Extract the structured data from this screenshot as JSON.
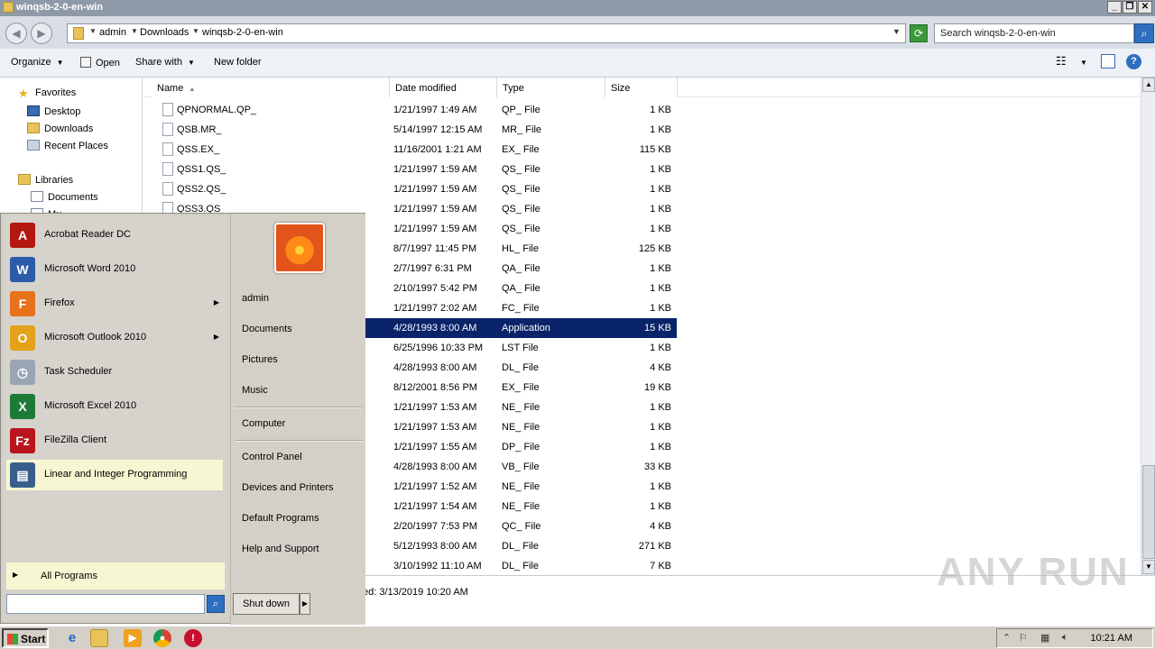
{
  "window": {
    "title": "winqsb-2-0-en-win"
  },
  "address": {
    "crumbs": [
      "admin",
      "Downloads",
      "winqsb-2-0-en-win"
    ],
    "search_placeholder": "Search winqsb-2-0-en-win"
  },
  "toolbar": {
    "organize": "Organize",
    "open": "Open",
    "share_with": "Share with",
    "new_folder": "New folder"
  },
  "nav": {
    "favorites": "Favorites",
    "desktop": "Desktop",
    "downloads": "Downloads",
    "recent_places": "Recent Places",
    "libraries": "Libraries",
    "documents": "Documents",
    "music_partial": "Mu"
  },
  "columns": {
    "name": "Name",
    "date": "Date modified",
    "type": "Type",
    "size": "Size"
  },
  "files": [
    {
      "name": "QPNORMAL.QP_",
      "date": "1/21/1997 1:49 AM",
      "type": "QP_ File",
      "size": "1 KB"
    },
    {
      "name": "QSB.MR_",
      "date": "5/14/1997 12:15 AM",
      "type": "MR_ File",
      "size": "1 KB"
    },
    {
      "name": "QSS.EX_",
      "date": "11/16/2001 1:21 AM",
      "type": "EX_ File",
      "size": "115 KB"
    },
    {
      "name": "QSS1.QS_",
      "date": "1/21/1997 1:59 AM",
      "type": "QS_ File",
      "size": "1 KB"
    },
    {
      "name": "QSS2.QS_",
      "date": "1/21/1997 1:59 AM",
      "type": "QS_ File",
      "size": "1 KB"
    },
    {
      "name": "QSS3.QS_",
      "date": "1/21/1997 1:59 AM",
      "type": "QS_ File",
      "size": "1 KB"
    },
    {
      "name": "",
      "date": "1/21/1997 1:59 AM",
      "type": "QS_ File",
      "size": "1 KB"
    },
    {
      "name": "",
      "date": "8/7/1997 11:45 PM",
      "type": "HL_ File",
      "size": "125 KB"
    },
    {
      "name": "",
      "date": "2/7/1997 6:31 PM",
      "type": "QA_ File",
      "size": "1 KB"
    },
    {
      "name": "",
      "date": "2/10/1997 5:42 PM",
      "type": "QA_ File",
      "size": "1 KB"
    },
    {
      "name": "",
      "date": "1/21/1997 2:02 AM",
      "type": "FC_ File",
      "size": "1 KB"
    },
    {
      "name": "",
      "date": "4/28/1993 8:00 AM",
      "type": "Application",
      "size": "15 KB"
    },
    {
      "name": "",
      "date": "6/25/1996 10:33 PM",
      "type": "LST File",
      "size": "1 KB"
    },
    {
      "name": "",
      "date": "4/28/1993 8:00 AM",
      "type": "DL_ File",
      "size": "4 KB"
    },
    {
      "name": "",
      "date": "8/12/2001 8:56 PM",
      "type": "EX_ File",
      "size": "19 KB"
    },
    {
      "name": "",
      "date": "1/21/1997 1:53 AM",
      "type": "NE_ File",
      "size": "1 KB"
    },
    {
      "name": "",
      "date": "1/21/1997 1:53 AM",
      "type": "NE_ File",
      "size": "1 KB"
    },
    {
      "name": "",
      "date": "1/21/1997 1:55 AM",
      "type": "DP_ File",
      "size": "1 KB"
    },
    {
      "name": "",
      "date": "4/28/1993 8:00 AM",
      "type": "VB_ File",
      "size": "33 KB"
    },
    {
      "name": "",
      "date": "1/21/1997 1:52 AM",
      "type": "NE_ File",
      "size": "1 KB"
    },
    {
      "name": "",
      "date": "1/21/1997 1:54 AM",
      "type": "NE_ File",
      "size": "1 KB"
    },
    {
      "name": "",
      "date": "2/20/1997 7:53 PM",
      "type": "QC_ File",
      "size": "4 KB"
    },
    {
      "name": "",
      "date": "5/12/1993 8:00 AM",
      "type": "DL_ File",
      "size": "271 KB"
    },
    {
      "name": "",
      "date": "3/10/1992 11:10 AM",
      "type": "DL_ File",
      "size": "7 KB"
    }
  ],
  "selected_row": 11,
  "details": {
    "text": "ed: 3/13/2019 10:20 AM"
  },
  "start_menu": {
    "programs": [
      {
        "label": "Acrobat Reader DC",
        "icon": "acrobat-icon",
        "color": "#b3170e",
        "glyph": "A"
      },
      {
        "label": "Microsoft Word 2010",
        "icon": "word-icon",
        "color": "#2a5caa",
        "glyph": "W"
      },
      {
        "label": "Firefox",
        "icon": "firefox-icon",
        "color": "#e8711c",
        "glyph": "F"
      },
      {
        "label": "Microsoft Outlook 2010",
        "icon": "outlook-icon",
        "color": "#e3a21a",
        "glyph": "O"
      },
      {
        "label": "Task Scheduler",
        "icon": "clock-icon",
        "color": "#9aa5b4",
        "glyph": "◷"
      },
      {
        "label": "Microsoft Excel 2010",
        "icon": "excel-icon",
        "color": "#1f7a3a",
        "glyph": "X"
      },
      {
        "label": "FileZilla Client",
        "icon": "filezilla-icon",
        "color": "#b8151c",
        "glyph": "Fz"
      },
      {
        "label": "Linear and Integer Programming",
        "icon": "program-window-icon",
        "color": "#3a5e8c",
        "glyph": "▤"
      }
    ],
    "all_programs": "All Programs",
    "right_items": [
      "admin",
      "Documents",
      "Pictures",
      "Music",
      "Computer",
      "Control Panel",
      "Devices and Printers",
      "Default Programs",
      "Help and Support"
    ],
    "shutdown": "Shut down"
  },
  "taskbar": {
    "start": "Start",
    "clock": "10:21 AM"
  },
  "watermark": "ANY RUN"
}
